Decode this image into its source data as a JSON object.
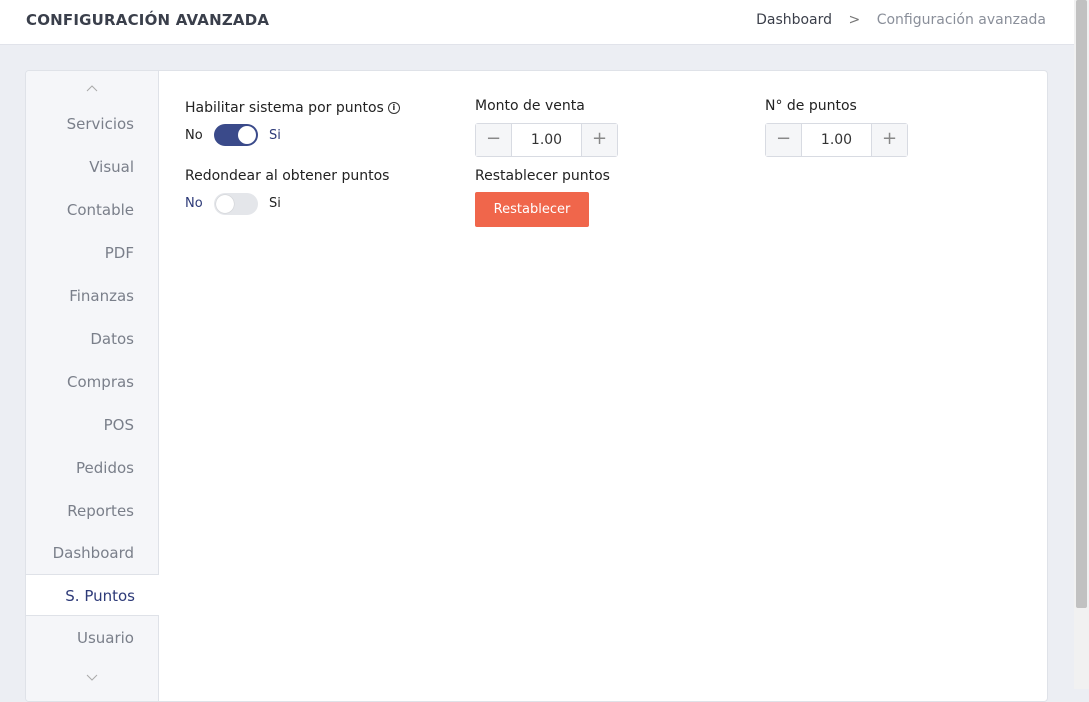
{
  "header": {
    "title": "CONFIGURACIÓN AVANZADA",
    "breadcrumb": [
      "Dashboard",
      "Configuración avanzada"
    ],
    "separator": ">"
  },
  "tabs": {
    "up_arrow": "chevron-up-icon",
    "down_arrow": "chevron-down-icon",
    "items": [
      "Servicios",
      "Visual",
      "Contable",
      "PDF",
      "Finanzas",
      "Datos",
      "Compras",
      "POS",
      "Pedidos",
      "Reportes",
      "Dashboard",
      "S. Puntos",
      "Usuario"
    ],
    "active": "S. Puntos"
  },
  "settings": {
    "points_system": {
      "label": "Habilitar sistema por puntos",
      "off_text": "No",
      "on_text": "Si",
      "enabled": true
    },
    "round_points": {
      "label": "Redondear al obtener puntos",
      "off_text": "No",
      "on_text": "Si",
      "enabled": false
    },
    "sale_amount": {
      "label": "Monto de venta",
      "value": "1.00"
    },
    "points_count": {
      "label": "N° de puntos",
      "value": "1.00"
    },
    "reset": {
      "label": "Restablecer puntos",
      "button": "Restablecer"
    }
  },
  "colors": {
    "accent": "#3a4a8a",
    "danger": "#f0664b"
  }
}
